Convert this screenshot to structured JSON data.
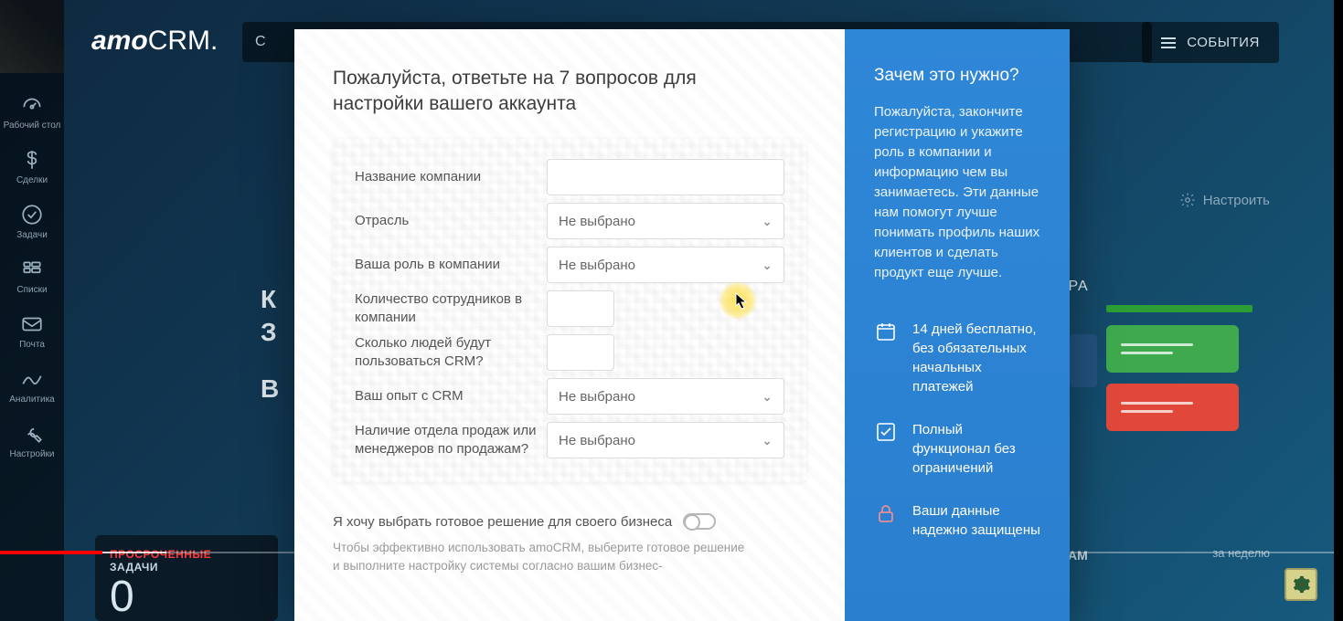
{
  "logo": {
    "a": "amo",
    "b": "CRM."
  },
  "topbar": {
    "events": "СОБЫТИЯ"
  },
  "settings_link": "Настроить",
  "sidebar": {
    "items": [
      {
        "label": "Рабочий стол"
      },
      {
        "label": "Сделки"
      },
      {
        "label": "Задачи"
      },
      {
        "label": "Списки"
      },
      {
        "label": "Почта"
      },
      {
        "label": "Аналитика"
      },
      {
        "label": "Настройки"
      }
    ]
  },
  "dash": {
    "letterK": "К",
    "letterE": "В",
    "right_word_fragment": "ОРА",
    "period": "за неделю",
    "overdue": {
      "line1": "ПРОСРОЧЕННЫЕ",
      "line2": "ЗАДАЧИ",
      "count": "0"
    },
    "am": "AM"
  },
  "modal": {
    "heading": "Пожалуйста, ответьте на 7 вопросов для настройки вашего аккаунта",
    "placeholder_select": "Не выбрано",
    "fields": {
      "company": "Название компании",
      "industry": "Отрасль",
      "role": "Ваша роль в компании",
      "employees": "Количество сотрудников в компании",
      "crm_users": "Сколько людей будут пользоваться CRM?",
      "experience": "Ваш опыт с CRM",
      "has_sales": "Наличие отдела продаж или менеджеров по продажам?"
    },
    "section2": {
      "title": "Я хочу выбрать готовое решение для своего бизнеса",
      "desc": "Чтобы эффективно использовать amoCRM, выберите готовое решение и выполните настройку системы согласно вашим бизнес-"
    },
    "right": {
      "title": "Зачем это нужно?",
      "blurb": "Пожалуйста, закончите регистрацию и укажите роль в компании и информацию чем вы занимаетесь. Эти данные нам помогут лучше понимать профиль наших клиентов и сделать продукт еще лучше.",
      "benefits": [
        "14 дней бесплатно, без обязательных начальных платежей",
        "Полный функционал без ограничений",
        "Ваши данные надежно защищены"
      ]
    }
  }
}
